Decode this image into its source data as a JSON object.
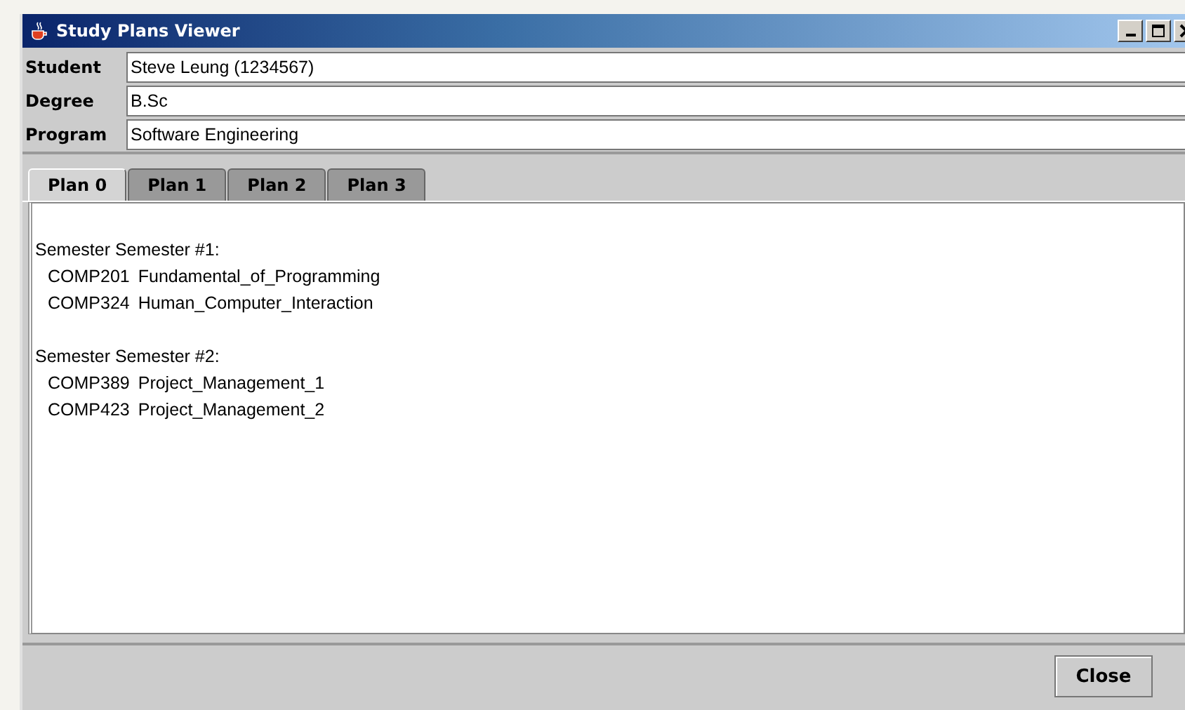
{
  "window": {
    "title": "Study Plans Viewer"
  },
  "fields": [
    {
      "label": "Student",
      "value": "Steve Leung (1234567)"
    },
    {
      "label": "Degree",
      "value": "B.Sc"
    },
    {
      "label": "Program",
      "value": "Software Engineering"
    }
  ],
  "tabs": [
    {
      "label": "Plan 0",
      "selected": true
    },
    {
      "label": "Plan 1",
      "selected": false
    },
    {
      "label": "Plan 2",
      "selected": false
    },
    {
      "label": "Plan 3",
      "selected": false
    }
  ],
  "semesters": [
    {
      "title": "Semester Semester #1:",
      "courses": [
        {
          "code": "COMP201",
          "name": "Fundamental_of_Programming"
        },
        {
          "code": "COMP324",
          "name": "Human_Computer_Interaction"
        }
      ]
    },
    {
      "title": "Semester Semester #2:",
      "courses": [
        {
          "code": "COMP389",
          "name": "Project_Management_1"
        },
        {
          "code": "COMP423",
          "name": "Project_Management_2"
        }
      ]
    }
  ],
  "buttons": [
    "Close"
  ]
}
